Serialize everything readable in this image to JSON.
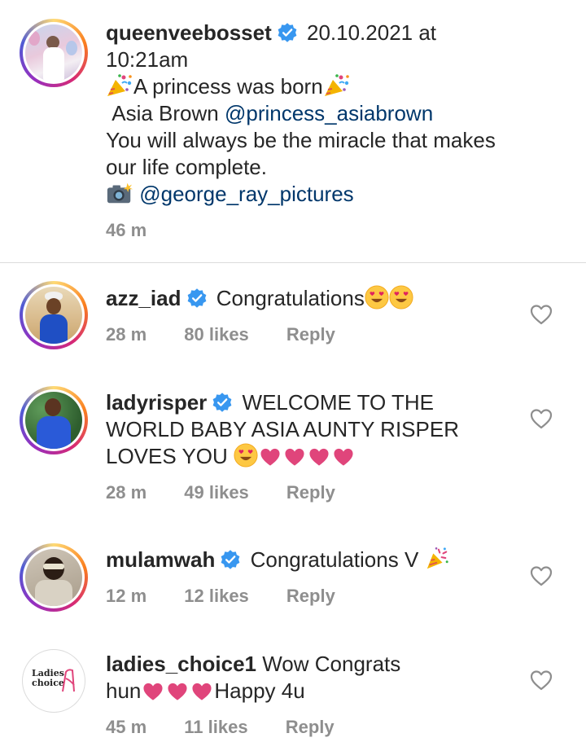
{
  "post": {
    "username": "queenveebosset",
    "date": "20.10.2021 at",
    "time": "10:21am",
    "caption_line1": "A princess was born",
    "caption_line2_text": "Asia Brown",
    "caption_line2_mention": "@princess_asiabrown",
    "caption_line3": "You will always be the miracle that makes",
    "caption_line4": "our life complete.",
    "caption_photo_mention": "@george_ray_pictures",
    "age": "46 m"
  },
  "comments": [
    {
      "username": "azz_iad",
      "text": "Congratulations",
      "age": "28 m",
      "likes": "80 likes",
      "reply": "Reply"
    },
    {
      "username": "ladyrisper",
      "text_line1": "WELCOME TO THE",
      "text_line2": "WORLD BABY ASIA AUNTY RISPER",
      "text_line3": "LOVES YOU",
      "age": "28 m",
      "likes": "49 likes",
      "reply": "Reply"
    },
    {
      "username": "mulamwah",
      "text": "Congratulations V",
      "age": "12 m",
      "likes": "12 likes",
      "reply": "Reply"
    },
    {
      "username": "ladies_choice1",
      "text_line1": "Wow Congrats",
      "text_line2a": "hun",
      "text_line2b": "Happy 4u",
      "age": "45 m",
      "likes": "11 likes",
      "reply": "Reply",
      "avatar_logo_line1": "Ladies",
      "avatar_logo_line2": "choice"
    }
  ],
  "colors": {
    "verified": "#3897f0",
    "mention": "#00376b",
    "meta": "#8e8e8e",
    "heart_emoji": "#e0457b"
  },
  "icons": [
    "verified-badge-icon",
    "heart-outline-icon",
    "confetti-icon",
    "camera-flash-icon",
    "heart-eyes-emoji-icon",
    "pink-heart-emoji-icon",
    "party-popper-icon"
  ]
}
